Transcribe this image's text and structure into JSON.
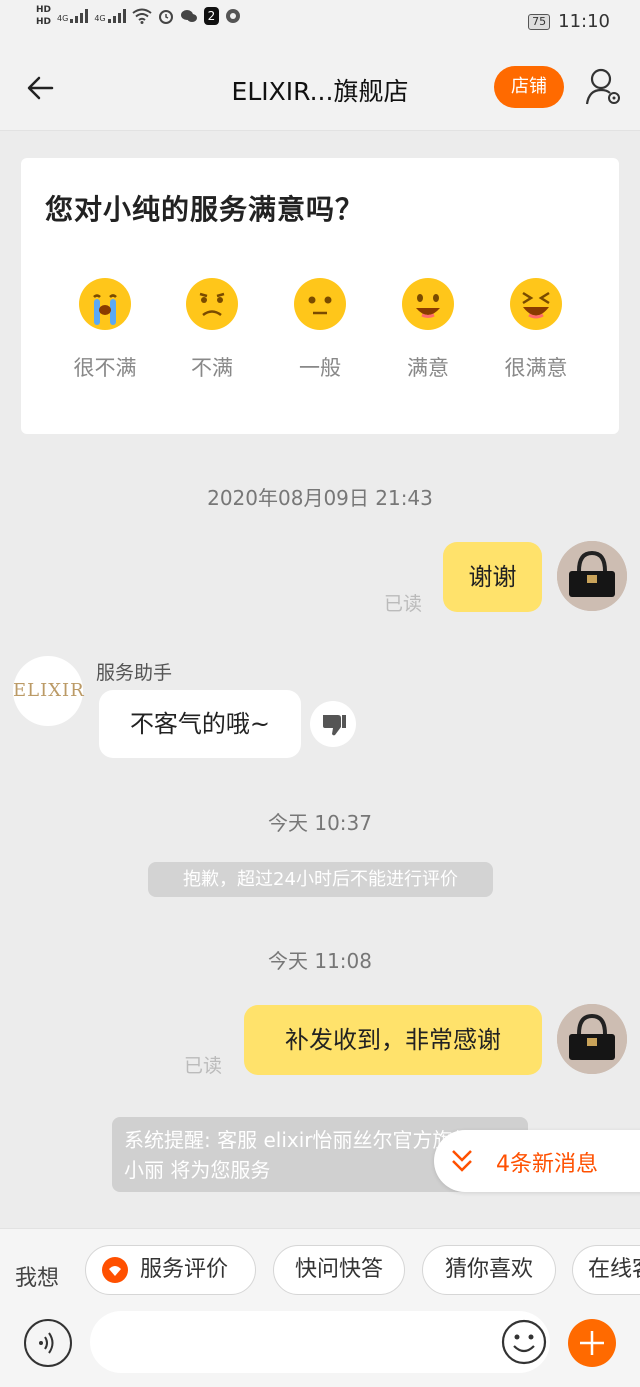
{
  "status_bar": {
    "hd_top": "HD",
    "hd_bottom": "HD",
    "net1": "4G",
    "net2": "4G",
    "notification_count": "2",
    "battery": "75",
    "time": "11:10"
  },
  "nav": {
    "title": "ELIXIR...旗舰店",
    "shop_label": "店铺"
  },
  "rating": {
    "question": "您对小纯的服务满意吗？",
    "options": [
      {
        "label": "很不满",
        "icon": "crying-face-icon"
      },
      {
        "label": "不满",
        "icon": "frowning-face-icon"
      },
      {
        "label": "一般",
        "icon": "neutral-face-icon"
      },
      {
        "label": "满意",
        "icon": "smiling-face-icon"
      },
      {
        "label": "很满意",
        "icon": "laughing-face-icon"
      }
    ]
  },
  "chat": {
    "timestamp1": "2020年08月09日 21:43",
    "msg1": {
      "text": "谢谢",
      "status": "已读"
    },
    "assistant_name": "服务助手",
    "assistant_avatar_text": "ELIXIR",
    "reply1": "不客气的哦~",
    "timestamp2": "今天  10:37",
    "notice": "抱歉，超过24小时后不能进行评价",
    "timestamp3": "今天  11:08",
    "msg2": {
      "text": "补发收到，非常感谢",
      "status": "已读"
    },
    "system_reminder": "系统提醒: 客服 elixir怡丽丝尔官方旗舰店:小丽 将为您服务",
    "new_messages": "4条新消息"
  },
  "quick_bar": {
    "label": "我想",
    "chips": [
      "服务评价",
      "快问快答",
      "猜你喜欢",
      "在线客服"
    ]
  },
  "input": {
    "placeholder": ""
  },
  "colors": {
    "accent": "#ff6a00",
    "bubble_self": "#ffe26b",
    "background": "#ececec"
  }
}
